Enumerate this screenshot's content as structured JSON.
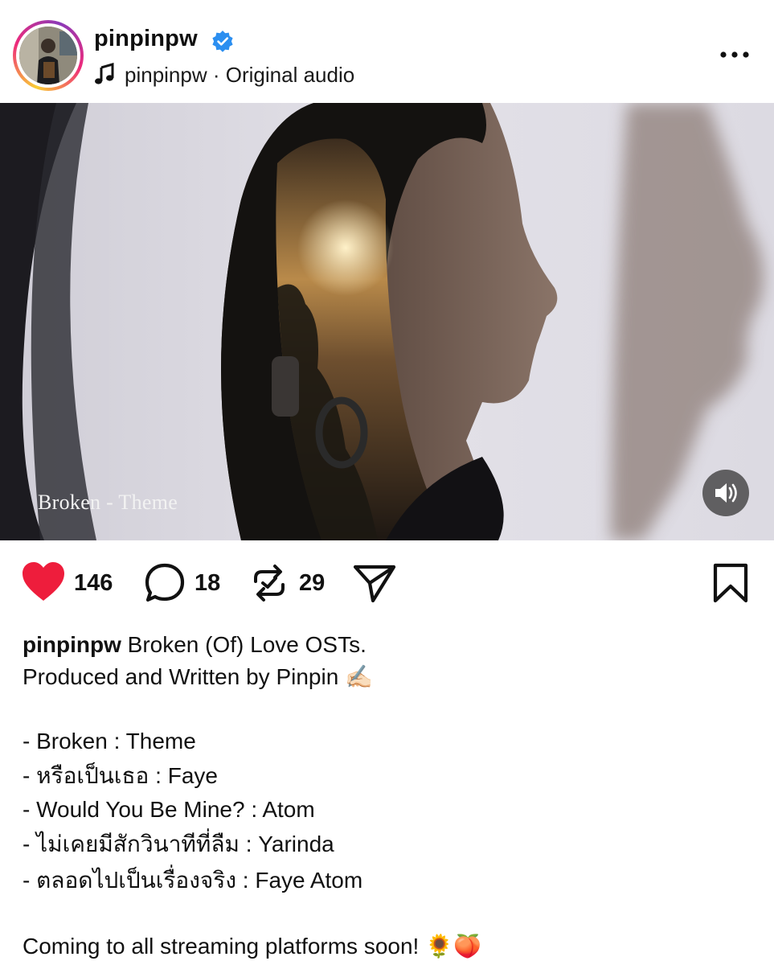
{
  "post": {
    "username": "pinpinpw",
    "audio_user": "pinpinpw",
    "audio_label": "Original audio",
    "audio_separator": " · "
  },
  "media": {
    "caption_text": "Broken - Theme",
    "volume_icon": "speaker-icon"
  },
  "actions": {
    "likes": "146",
    "comments": "18",
    "reposts": "29",
    "like_color": "#ee1d3c"
  },
  "caption": {
    "username": "pinpinpw",
    "first_text": " Broken (Of) Love OSTs.",
    "line2": "Produced and Written by Pinpin ✍🏻",
    "tracks": [
      "- Broken : Theme",
      "- หรือเป็นเธอ : Faye",
      "- Would You Be Mine? : Atom",
      "- ไม่เคยมีสักวินาทีที่ลืม : Yarinda",
      "- ตลอดไปเป็นเรื่องจริง : Faye Atom"
    ],
    "closing": "Coming to all streaming platforms soon! 🌻🍑"
  }
}
